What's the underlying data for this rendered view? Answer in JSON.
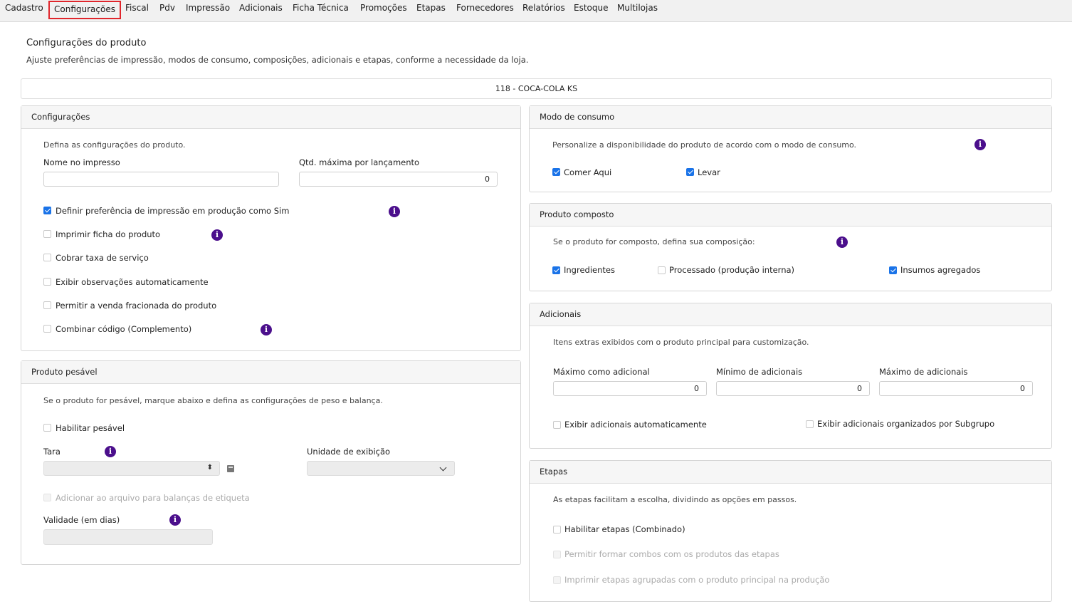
{
  "tabs": [
    {
      "label": "Cadastro",
      "active": false
    },
    {
      "label": "Configurações",
      "active": true
    },
    {
      "label": "Fiscal",
      "active": false
    },
    {
      "label": "Pdv",
      "active": false
    },
    {
      "label": "Impressão",
      "active": false
    },
    {
      "label": "Adicionais",
      "active": false
    },
    {
      "label": "Ficha Técnica",
      "active": false
    },
    {
      "label": "Promoções",
      "active": false
    },
    {
      "label": "Etapas",
      "active": false
    },
    {
      "label": "Fornecedores",
      "active": false
    },
    {
      "label": "Relatórios",
      "active": false
    },
    {
      "label": "Estoque",
      "active": false
    },
    {
      "label": "Multilojas",
      "active": false
    }
  ],
  "page": {
    "title": "Configurações do produto",
    "subtitle": "Ajuste preferências de impressão, modos de consumo, composições, adicionais e etapas, conforme a necessidade da loja.",
    "product": "118 - COCA-COLA KS"
  },
  "config": {
    "title": "Configurações",
    "description": "Defina as configurações do produto.",
    "name_label": "Nome no impresso",
    "name_value": "",
    "qty_label": "Qtd. máxima por lançamento",
    "qty_value": "0",
    "options": [
      {
        "label": "Definir preferência de impressão em produção como Sim",
        "checked": true
      },
      {
        "label": "Imprimir ficha do produto",
        "checked": false
      },
      {
        "label": "Cobrar taxa de serviço",
        "checked": false
      },
      {
        "label": "Exibir observações automaticamente",
        "checked": false
      },
      {
        "label": "Permitir a venda fracionada do produto",
        "checked": false
      },
      {
        "label": "Combinar código (Complemento)",
        "checked": false
      }
    ]
  },
  "weighable": {
    "title": "Produto pesável",
    "description": "Se o produto for pesável, marque abaixo e defina as configurações de peso e balança.",
    "enable_label": "Habilitar pesável",
    "enable_checked": false,
    "tara_label": "Tara",
    "tara_value": "",
    "unit_label": "Unidade de exibição",
    "unit_value": "",
    "label_scale": "Adicionar ao arquivo para balanças de etiqueta",
    "validity_label": "Validade (em dias)",
    "validity_value": ""
  },
  "consumption": {
    "title": "Modo de consumo",
    "description": "Personalize a disponibilidade do produto de acordo com o modo de consumo.",
    "options": [
      {
        "label": "Comer Aqui",
        "checked": true
      },
      {
        "label": "Levar",
        "checked": true
      }
    ]
  },
  "composite": {
    "title": "Produto composto",
    "description": "Se o produto for composto, defina sua composição:",
    "options": [
      {
        "label": "Ingredientes",
        "checked": true
      },
      {
        "label": "Processado (produção interna)",
        "checked": false
      },
      {
        "label": "Insumos agregados",
        "checked": true
      }
    ]
  },
  "addons": {
    "title": "Adicionais",
    "description": "Itens extras exibidos com o produto principal para customização.",
    "max_as_addon_label": "Máximo como adicional",
    "max_as_addon_value": "0",
    "min_addons_label": "Mínimo de adicionais",
    "min_addons_value": "0",
    "max_addons_label": "Máximo de adicionais",
    "max_addons_value": "0",
    "auto_label": "Exibir adicionais automaticamente",
    "subgroup_label": "Exibir adicionais organizados por Subgrupo"
  },
  "steps": {
    "title": "Etapas",
    "description": "As etapas facilitam a escolha, dividindo as opções em passos.",
    "enable_label": "Habilitar etapas (Combinado)",
    "combos_label": "Permitir formar combos com os produtos das etapas",
    "print_label": "Imprimir etapas agrupadas com o produto principal na produção"
  },
  "colors": {
    "active_tab_border": "#e0262c",
    "info_icon": "#4b0f8c",
    "checkbox_checked": "#1a73e8"
  }
}
